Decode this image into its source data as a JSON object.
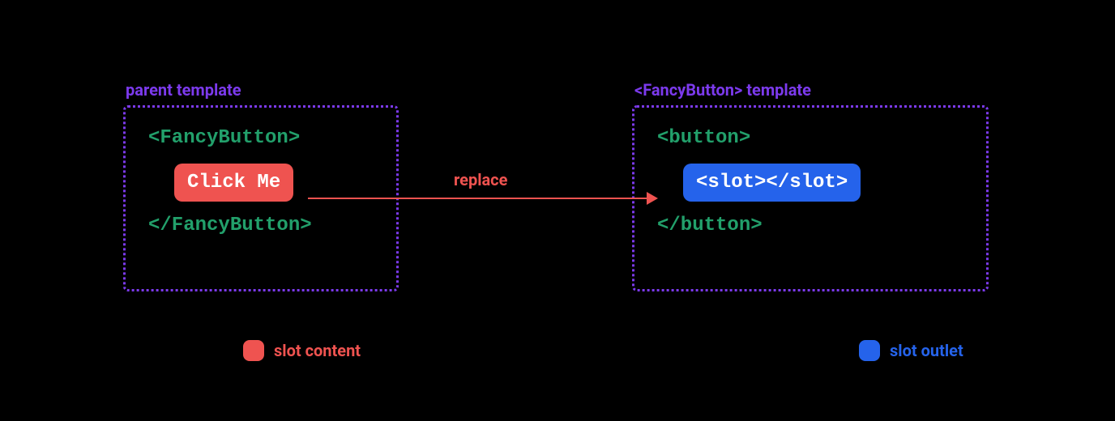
{
  "left_panel": {
    "label": "parent template",
    "open_tag": "<FancyButton>",
    "content": "Click Me",
    "close_tag": "</FancyButton>"
  },
  "right_panel": {
    "label": "<FancyButton> template",
    "open_tag": "<button>",
    "content": "<slot></slot>",
    "close_tag": "</button>"
  },
  "arrow": {
    "label": "replace"
  },
  "legend": {
    "left": "slot content",
    "right": "slot outlet"
  },
  "colors": {
    "purple": "#7c3aed",
    "green": "#22a06b",
    "red": "#ef5350",
    "blue": "#2563eb"
  }
}
